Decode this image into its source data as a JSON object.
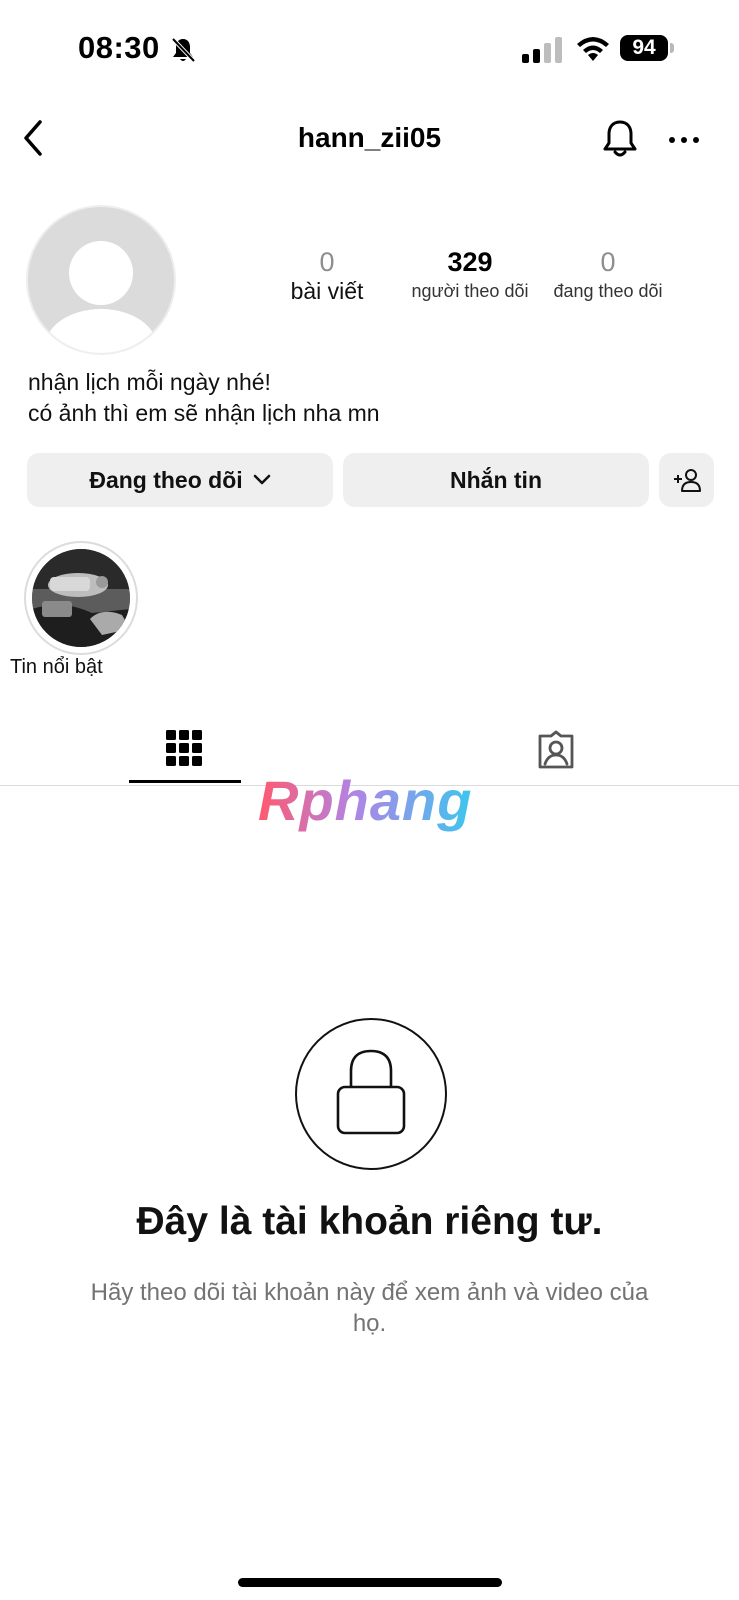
{
  "status_bar": {
    "time": "08:30",
    "battery": "94",
    "icons": [
      "bell-slash-icon",
      "cellular-signal-icon",
      "wifi-icon",
      "battery-icon"
    ]
  },
  "header": {
    "username": "hann_zii05",
    "icons": [
      "chevron-left-icon",
      "bell-icon",
      "more-horizontal-icon"
    ]
  },
  "profile": {
    "stats": [
      {
        "value": "0",
        "label": "bài viết"
      },
      {
        "value": "329",
        "label": "người theo dõi"
      },
      {
        "value": "0",
        "label": "đang theo dõi"
      }
    ],
    "bio": [
      "nhận lịch mỗi ngày nhé!",
      "có ảnh thì em sẽ nhận lịch nha mn"
    ]
  },
  "actions": {
    "following_label": "Đang theo dõi",
    "message_label": "Nhắn tin",
    "icons": [
      "chevron-down-icon",
      "add-user-icon"
    ]
  },
  "highlights": [
    {
      "label": "Tin nổi bật"
    }
  ],
  "tabs": {
    "active": "grid",
    "icons": [
      "grid-icon",
      "tagged-person-icon"
    ]
  },
  "watermark": "Rphang",
  "private": {
    "title": "Đây là tài khoản riêng tư.",
    "subtitle": "Hãy theo dõi tài khoản này để xem ảnh và video của họ."
  },
  "colors": {
    "button_bg": "#efefef",
    "divider": "#dbdbdb",
    "muted_text": "#737373"
  }
}
